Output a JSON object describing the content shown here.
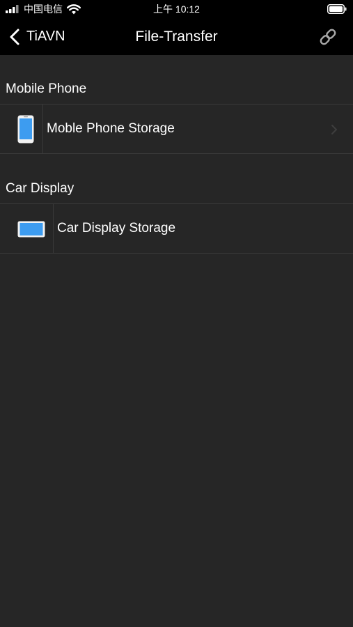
{
  "status_bar": {
    "carrier": "中国电信",
    "time": "上午 10:12",
    "icons": [
      "signal-icon",
      "wifi-icon",
      "battery-icon"
    ]
  },
  "nav": {
    "back_label": "TiAVN",
    "title": "File-Transfer",
    "back_icon": "chevron-left-icon",
    "action_icon": "link-icon"
  },
  "sections": [
    {
      "header": "Mobile Phone",
      "row": {
        "label": "Moble Phone Storage",
        "icon": "phone-icon",
        "has_chevron": true
      }
    },
    {
      "header": "Car Display",
      "row": {
        "label": "Car Display Storage",
        "icon": "tablet-icon",
        "has_chevron": false
      }
    }
  ],
  "colors": {
    "background": "#262626",
    "bar_background": "#000000",
    "separator": "#3a3a3a",
    "icon_blue": "#3d9cf0",
    "text": "#ffffff"
  }
}
